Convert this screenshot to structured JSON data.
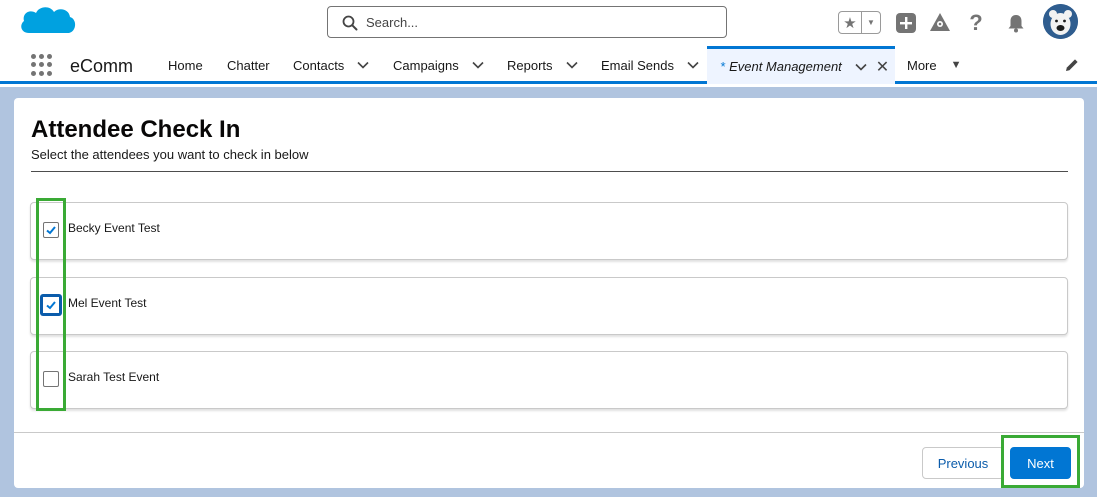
{
  "header": {
    "search_placeholder": "Search...",
    "icons": [
      "salesforce-cloud-logo",
      "search-icon",
      "star-icon",
      "plus-icon",
      "setup-tree-icon",
      "help-icon",
      "bell-icon",
      "avatar"
    ]
  },
  "nav": {
    "app_name": "eComm",
    "items": [
      {
        "label": "Home",
        "has_menu": false
      },
      {
        "label": "Chatter",
        "has_menu": false
      },
      {
        "label": "Contacts",
        "has_menu": true
      },
      {
        "label": "Campaigns",
        "has_menu": true
      },
      {
        "label": "Reports",
        "has_menu": true
      },
      {
        "label": "Email Sends",
        "has_menu": true
      }
    ],
    "active_tab": {
      "prefix": "*",
      "label": "Event Management"
    },
    "more_label": "More"
  },
  "page": {
    "title": "Attendee Check In",
    "subtitle": "Select the attendees you want to check in below"
  },
  "attendees": [
    {
      "name": "Becky Event Test",
      "checked": true
    },
    {
      "name": "Mel Event Test",
      "checked": true
    },
    {
      "name": "Sarah Test Event",
      "checked": false
    }
  ],
  "footer": {
    "previous_label": "Previous",
    "next_label": "Next"
  },
  "colors": {
    "brand_blue": "#0176d3",
    "highlight_green": "#3aaa35",
    "background_band": "#b0c4df"
  }
}
